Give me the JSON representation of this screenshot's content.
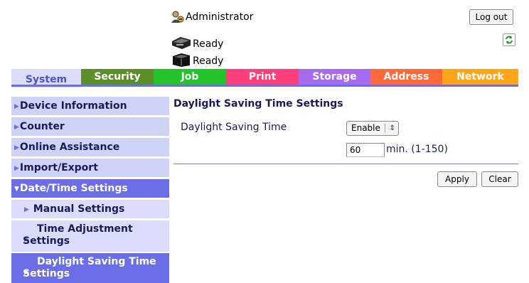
{
  "header": {
    "user": "Administrator",
    "logout_label": "Log out",
    "status": [
      "Ready",
      "Ready"
    ]
  },
  "tabs": [
    {
      "label": "System",
      "color": "#dcdcff",
      "active": true
    },
    {
      "label": "Security",
      "color": "#5a8f2a"
    },
    {
      "label": "Job",
      "color": "#23c32a"
    },
    {
      "label": "Print",
      "color": "#ff3f7a"
    },
    {
      "label": "Storage",
      "color": "#a66cf0"
    },
    {
      "label": "Address",
      "color": "#ff6a3a"
    },
    {
      "label": "Network",
      "color": "#ffa51a"
    }
  ],
  "sidebar": {
    "items": [
      {
        "label": "Device Information"
      },
      {
        "label": "Counter"
      },
      {
        "label": "Online Assistance"
      },
      {
        "label": "Import/Export"
      },
      {
        "label": "Date/Time Settings"
      },
      {
        "label": "Manual Settings"
      },
      {
        "label": "Time Adjustment Settings"
      },
      {
        "label": "Daylight Saving Time Settings"
      }
    ]
  },
  "main": {
    "title": "Daylight Saving Time Settings",
    "dst_label": "Daylight Saving Time",
    "dst_value": "Enable",
    "minutes_value": "60",
    "minutes_unit": "min. (1-150)",
    "apply_label": "Apply",
    "clear_label": "Clear"
  }
}
